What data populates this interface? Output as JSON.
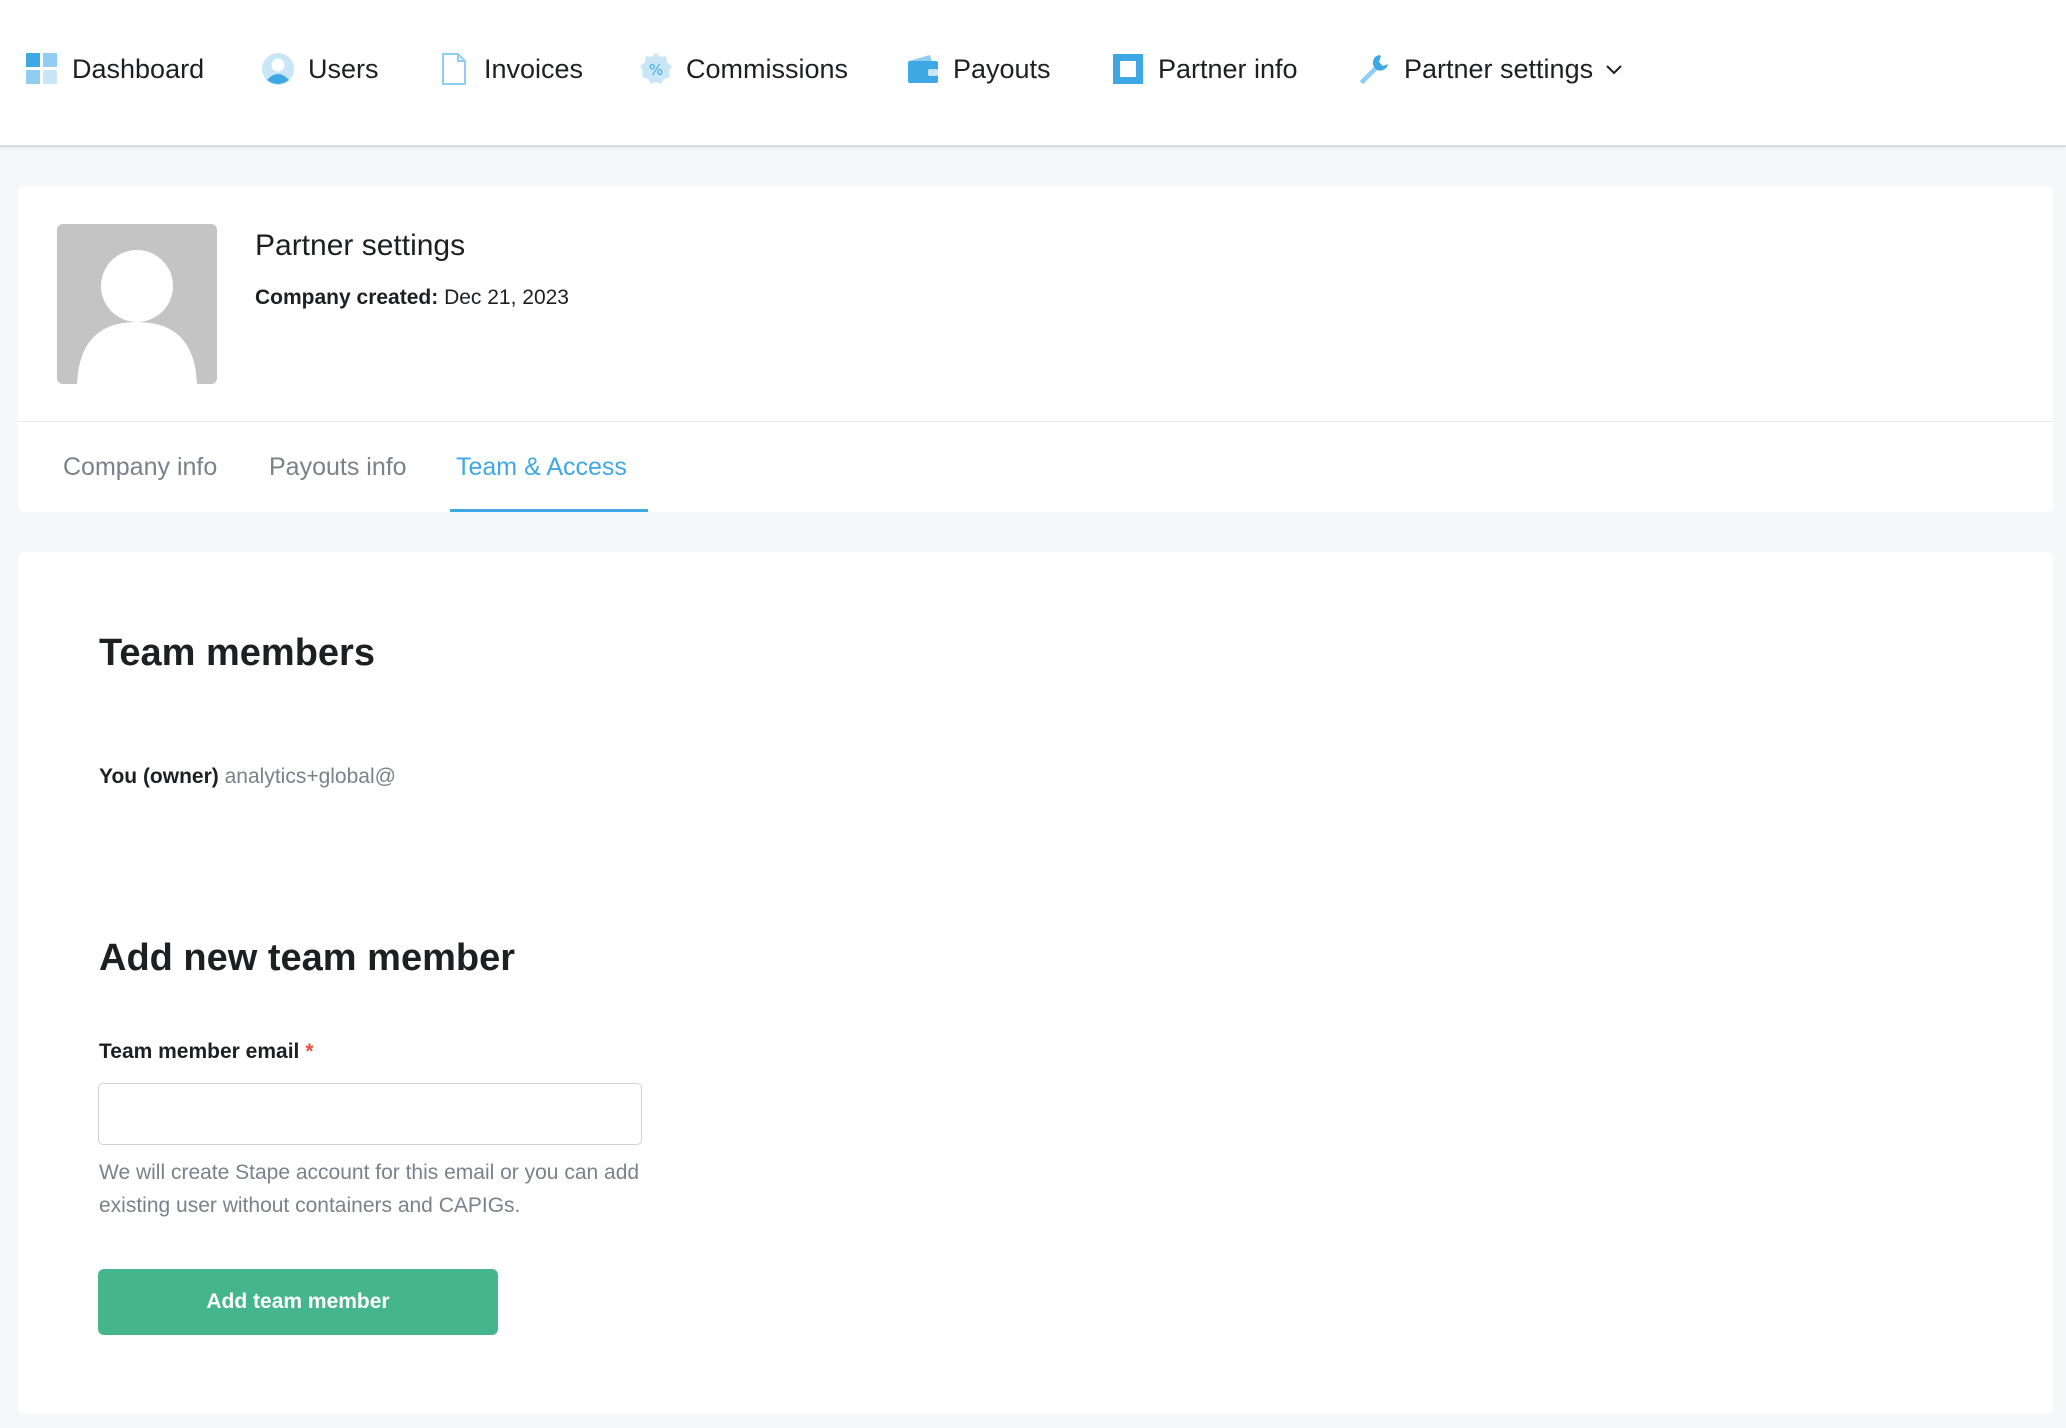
{
  "nav": {
    "items": [
      {
        "label": "Dashboard",
        "icon": "dashboard-grid-icon"
      },
      {
        "label": "Users",
        "icon": "user-icon"
      },
      {
        "label": "Invoices",
        "icon": "document-icon"
      },
      {
        "label": "Commissions",
        "icon": "percent-badge-icon"
      },
      {
        "label": "Payouts",
        "icon": "wallet-icon"
      },
      {
        "label": "Partner info",
        "icon": "square-icon"
      },
      {
        "label": "Partner settings",
        "icon": "wrench-icon"
      }
    ],
    "accent_color": "#3ea8e5"
  },
  "header": {
    "title": "Partner settings",
    "created_label": "Company created:",
    "created_value": "Dec 21, 2023"
  },
  "tabs": [
    {
      "label": "Company info",
      "active": false
    },
    {
      "label": "Payouts info",
      "active": false
    },
    {
      "label": "Team & Access",
      "active": true
    }
  ],
  "team": {
    "heading": "Team members",
    "owner_label": "You (owner)",
    "owner_email": "analytics+global@"
  },
  "add_member": {
    "heading": "Add new team member",
    "email_label": "Team member email",
    "required_mark": "*",
    "email_value": "",
    "hint": "We will create Stape account for this email or you can add existing user without containers and CAPIGs.",
    "button_label": "Add team member",
    "button_color": "#44b58c"
  }
}
